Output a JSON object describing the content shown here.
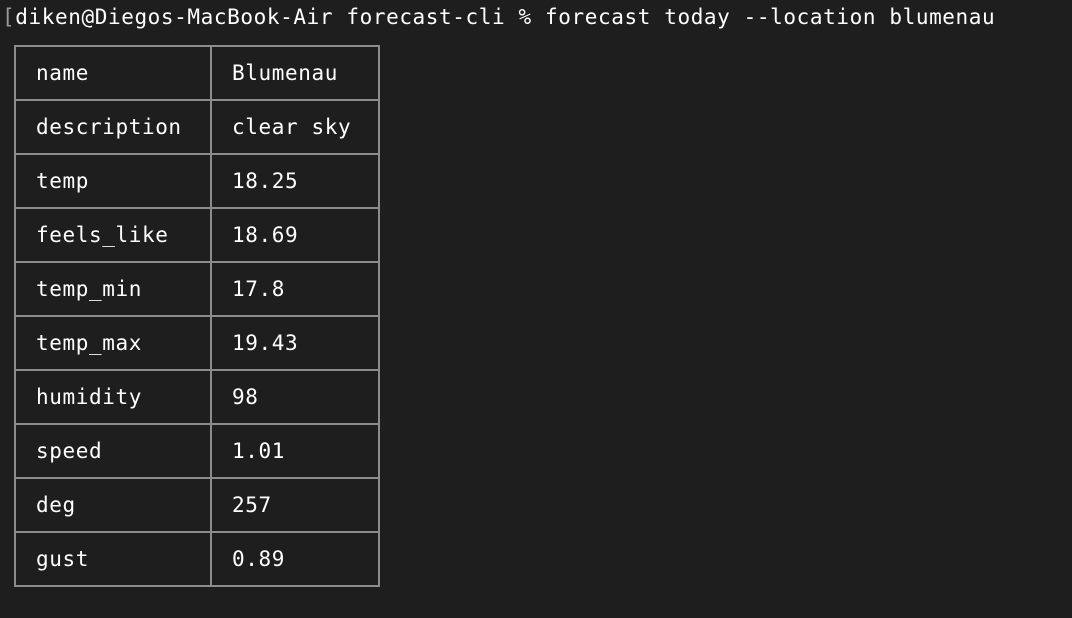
{
  "terminal": {
    "prompt": {
      "marker": "[",
      "user_host": "diken@Diegos-MacBook-Air",
      "directory": "forecast-cli",
      "symbol": "%",
      "command": "forecast today --location blumenau"
    },
    "rows": [
      {
        "key": "name",
        "value": "Blumenau"
      },
      {
        "key": "description",
        "value": "clear sky"
      },
      {
        "key": "temp",
        "value": "18.25"
      },
      {
        "key": "feels_like",
        "value": "18.69"
      },
      {
        "key": "temp_min",
        "value": "17.8"
      },
      {
        "key": "temp_max",
        "value": "19.43"
      },
      {
        "key": "humidity",
        "value": "98"
      },
      {
        "key": "speed",
        "value": "1.01"
      },
      {
        "key": "deg",
        "value": "257"
      },
      {
        "key": "gust",
        "value": "0.89"
      }
    ]
  }
}
